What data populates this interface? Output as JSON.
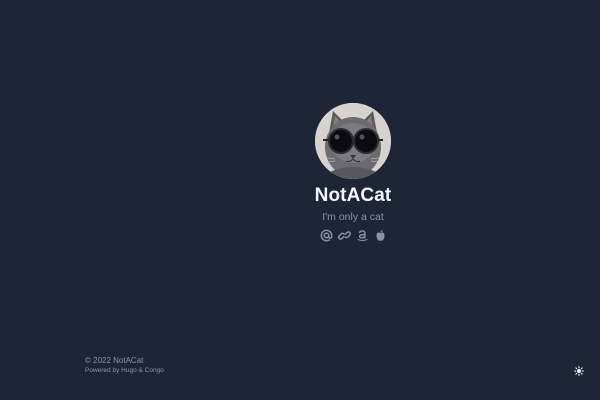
{
  "profile": {
    "name": "NotACat",
    "tagline": "I'm only a cat"
  },
  "social_links": [
    {
      "icon": "at-icon",
      "label": "email"
    },
    {
      "icon": "link-icon",
      "label": "link"
    },
    {
      "icon": "amazon-icon",
      "label": "amazon"
    },
    {
      "icon": "apple-icon",
      "label": "apple"
    }
  ],
  "footer": {
    "copyright": "© 2022 NotACat",
    "powered_prefix": "Powered by ",
    "hugo": "Hugo",
    "amp": " & ",
    "congo": "Congo"
  },
  "theme_toggle": {
    "icon": "sun-icon"
  },
  "colors": {
    "background": "#1e2535",
    "name_text": "#f4f5f7",
    "muted_text": "#8b94a6"
  }
}
